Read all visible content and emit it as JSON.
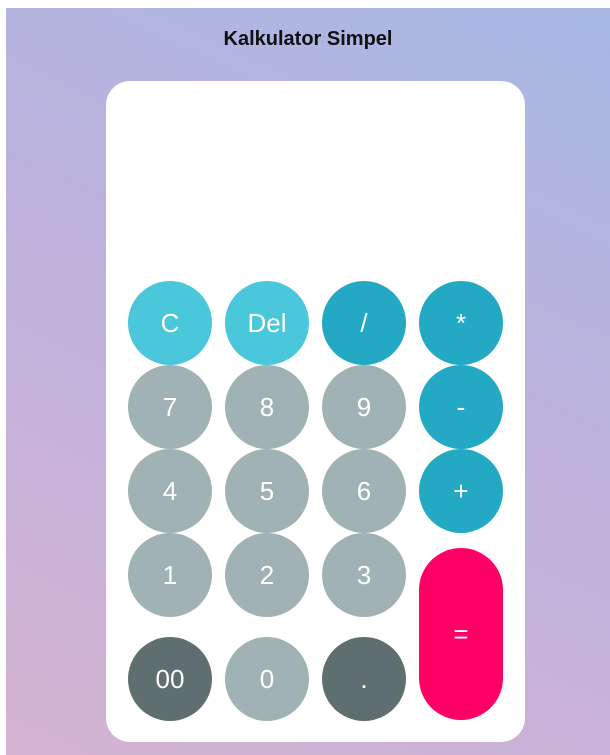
{
  "app": {
    "title": "Kalkulator Simpel"
  },
  "display": {
    "value": ""
  },
  "colors": {
    "light_cyan": "#4ac7da",
    "dark_cyan": "#23a9c3",
    "gray": "#a1b2b5",
    "dark_gray": "#5f6e6e",
    "equals_pink": "#ff0066"
  },
  "keys": {
    "clear": "C",
    "delete": "Del",
    "divide": "/",
    "multiply": "*",
    "seven": "7",
    "eight": "8",
    "nine": "9",
    "minus": "-",
    "four": "4",
    "five": "5",
    "six": "6",
    "plus": "+",
    "one": "1",
    "two": "2",
    "three": "3",
    "equals": "=",
    "double_zero": "00",
    "zero": "0",
    "dot": "."
  }
}
